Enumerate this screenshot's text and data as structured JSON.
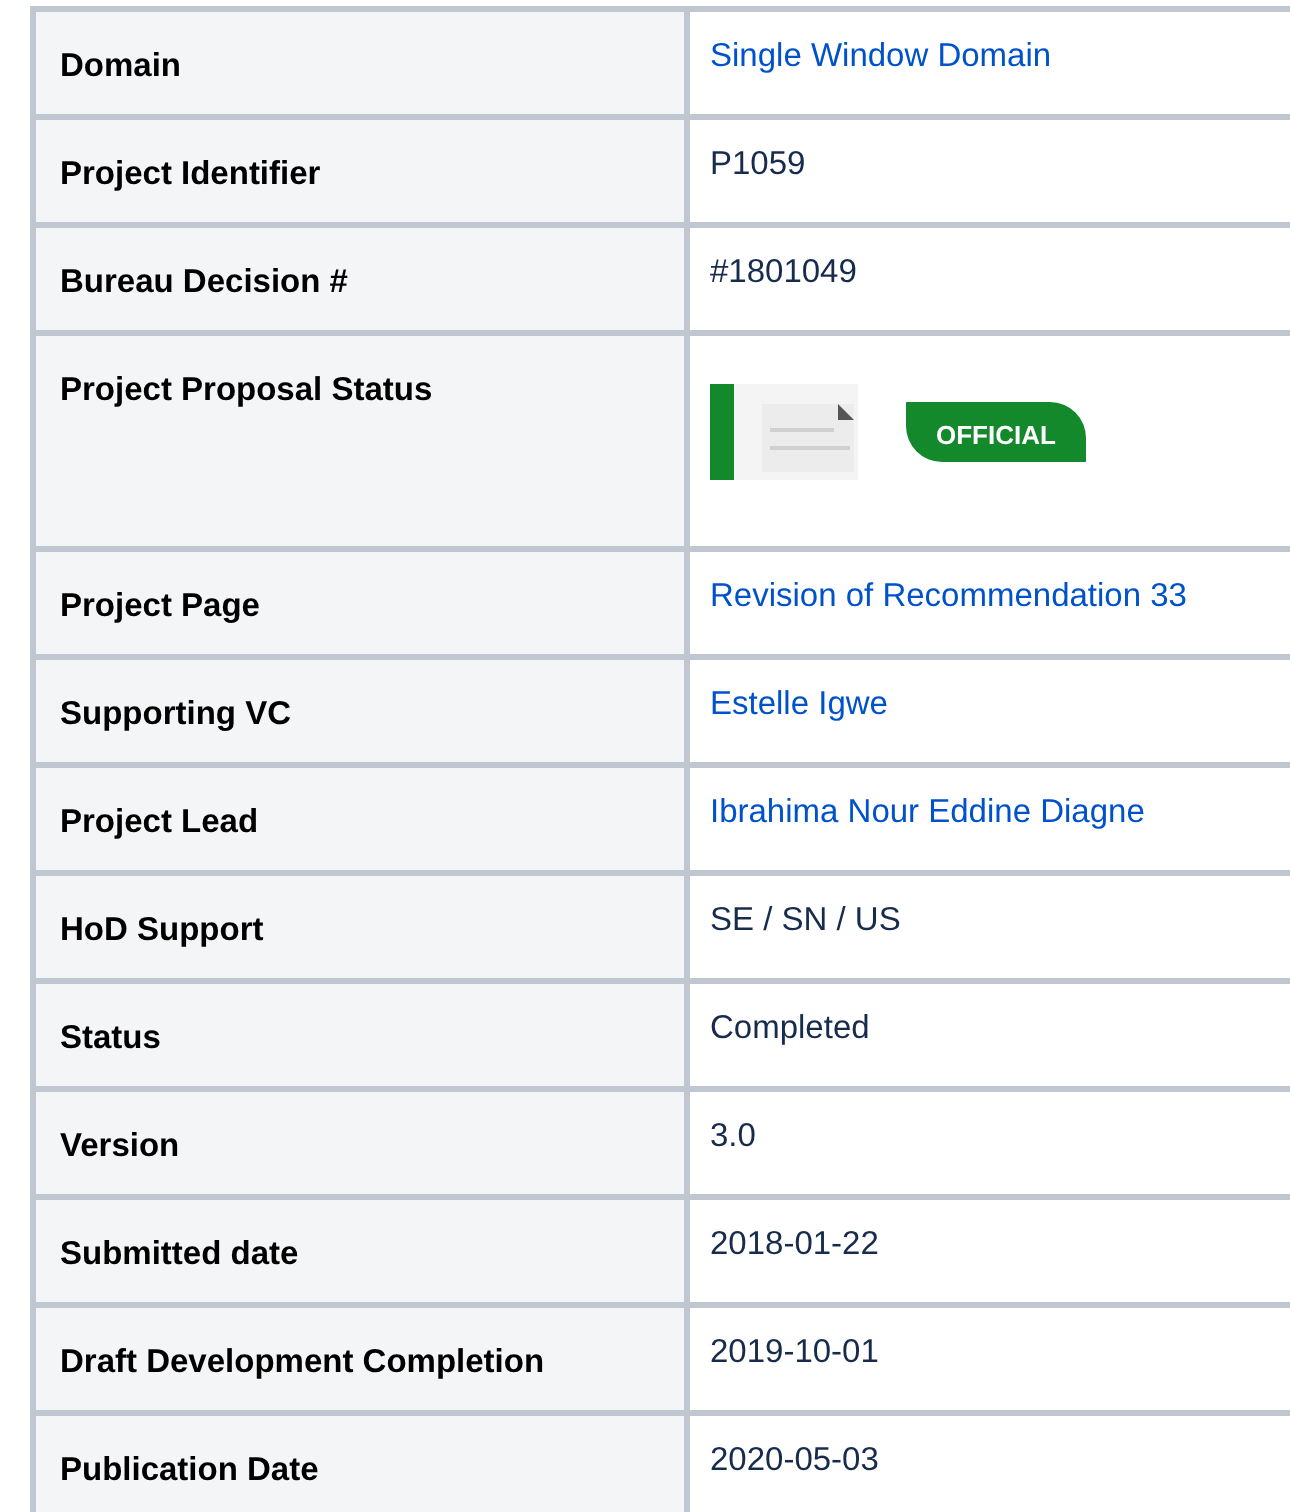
{
  "table": {
    "rows": [
      {
        "label": "Domain",
        "kind": "link",
        "value": "Single Window Domain"
      },
      {
        "label": "Project Identifier",
        "kind": "text",
        "value": "P1059"
      },
      {
        "label": "Bureau Decision #",
        "kind": "text",
        "value": "#1801049"
      },
      {
        "label": "Project Proposal Status",
        "kind": "status",
        "value": "OFFICIAL"
      },
      {
        "label": "Project Page",
        "kind": "link",
        "value": "Revision of Recommendation 33"
      },
      {
        "label": "Supporting VC",
        "kind": "link",
        "value": "Estelle Igwe"
      },
      {
        "label": "Project Lead",
        "kind": "link",
        "value": "Ibrahima Nour Eddine Diagne"
      },
      {
        "label": "HoD Support",
        "kind": "text",
        "value": "SE / SN / US"
      },
      {
        "label": "Status",
        "kind": "text",
        "value": "Completed"
      },
      {
        "label": "Version",
        "kind": "text",
        "value": "3.0"
      },
      {
        "label": "Submitted date",
        "kind": "text",
        "value": "2018-01-22"
      },
      {
        "label": "Draft Development Completion",
        "kind": "text",
        "value": "2019-10-01"
      },
      {
        "label": "Publication Date",
        "kind": "text",
        "value": "2020-05-03"
      }
    ]
  }
}
